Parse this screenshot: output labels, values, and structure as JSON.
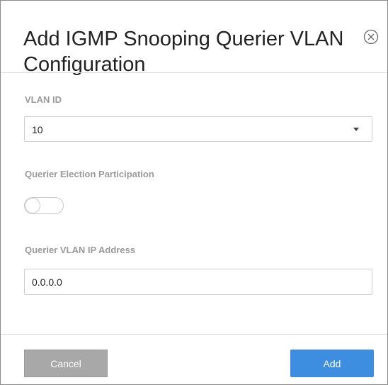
{
  "dialog": {
    "title": "Add IGMP Snooping Querier VLAN Configuration",
    "close_icon": "close-circle-icon"
  },
  "form": {
    "vlan_id": {
      "label": "VLAN ID",
      "value": "10"
    },
    "querier_election": {
      "label": "Querier Election Participation",
      "enabled": false
    },
    "querier_ip": {
      "label": "Querier VLAN IP Address",
      "value": "0.0.0.0"
    }
  },
  "footer": {
    "cancel_label": "Cancel",
    "add_label": "Add"
  },
  "colors": {
    "primary": "#3d8ee0",
    "cancel": "#a8a8a8",
    "label": "#9a9a9a"
  }
}
